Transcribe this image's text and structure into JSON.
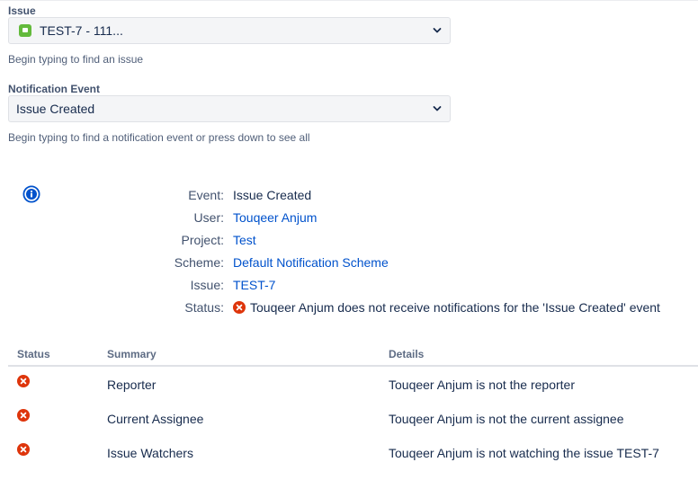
{
  "issue_field": {
    "label": "Issue",
    "value": "TEST-7 - 111...",
    "help": "Begin typing to find an issue"
  },
  "event_field": {
    "label": "Notification Event",
    "value": "Issue Created",
    "help": "Begin typing to find a notification event or press down to see all"
  },
  "details": {
    "event": {
      "label": "Event:",
      "value": "Issue Created"
    },
    "user": {
      "label": "User:",
      "value": "Touqeer Anjum"
    },
    "project": {
      "label": "Project:",
      "value": "Test"
    },
    "scheme": {
      "label": "Scheme:",
      "value": "Default Notification Scheme"
    },
    "issue": {
      "label": "Issue:",
      "value": "TEST-7"
    },
    "status": {
      "label": "Status:",
      "value": "Touqeer Anjum does not receive notifications for the 'Issue Created' event"
    }
  },
  "table": {
    "headers": {
      "status": "Status",
      "summary": "Summary",
      "details": "Details"
    },
    "rows": [
      {
        "summary": "Reporter",
        "details": "Touqeer Anjum is not the reporter"
      },
      {
        "summary": "Current Assignee",
        "details": "Touqeer Anjum is not the current assignee"
      },
      {
        "summary": "Issue Watchers",
        "details": "Touqeer Anjum is not watching the issue TEST-7"
      }
    ]
  },
  "colors": {
    "link": "#0052cc",
    "error": "#de350b",
    "issue_type": "#63ba3c",
    "info": "#0052cc"
  }
}
